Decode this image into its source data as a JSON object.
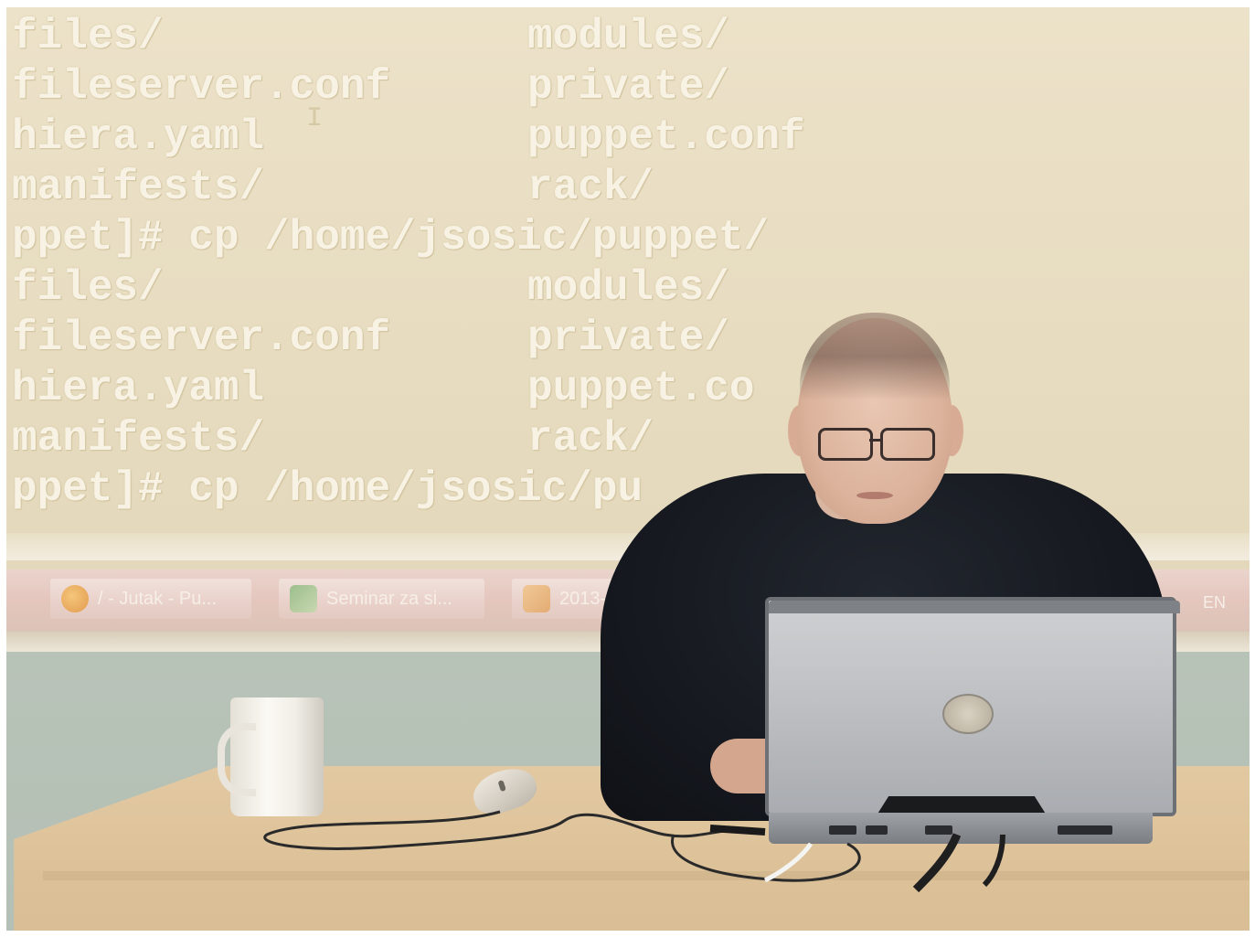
{
  "terminal": {
    "lines": [
      {
        "col1": "files/",
        "col2": "modules/"
      },
      {
        "col1": "fileserver.conf",
        "col2": "private/"
      },
      {
        "col1": "hiera.yaml",
        "col2": "puppet.conf"
      },
      {
        "col1": "manifests/",
        "col2": "rack/"
      },
      {
        "col1": "ppet]# cp /home/jsosic/puppet/",
        "col2": ""
      },
      {
        "col1": "files/",
        "col2": "modules/"
      },
      {
        "col1": "fileserver.conf",
        "col2": "private/"
      },
      {
        "col1": "hiera.yaml",
        "col2": "puppet.co"
      },
      {
        "col1": "manifests/",
        "col2": "rack/"
      },
      {
        "col1": "ppet]# cp /home/jsosic/pu",
        "col2": ""
      }
    ]
  },
  "taskbar": {
    "items": [
      {
        "label": "/ - Jutak - Pu...",
        "icon": "firefox-icon"
      },
      {
        "label": "Seminar za si...",
        "icon": "image-viewer-icon"
      },
      {
        "label": "2013-pup",
        "icon": "document-icon"
      }
    ],
    "language": "EN"
  },
  "colors": {
    "screen": "#e7dcc0",
    "terminal_text": "#f7f2e3",
    "wall": "#b8c3b8",
    "desk": "#dcc198",
    "sweater": "#14171d",
    "laptop": "#bdbfc2"
  }
}
